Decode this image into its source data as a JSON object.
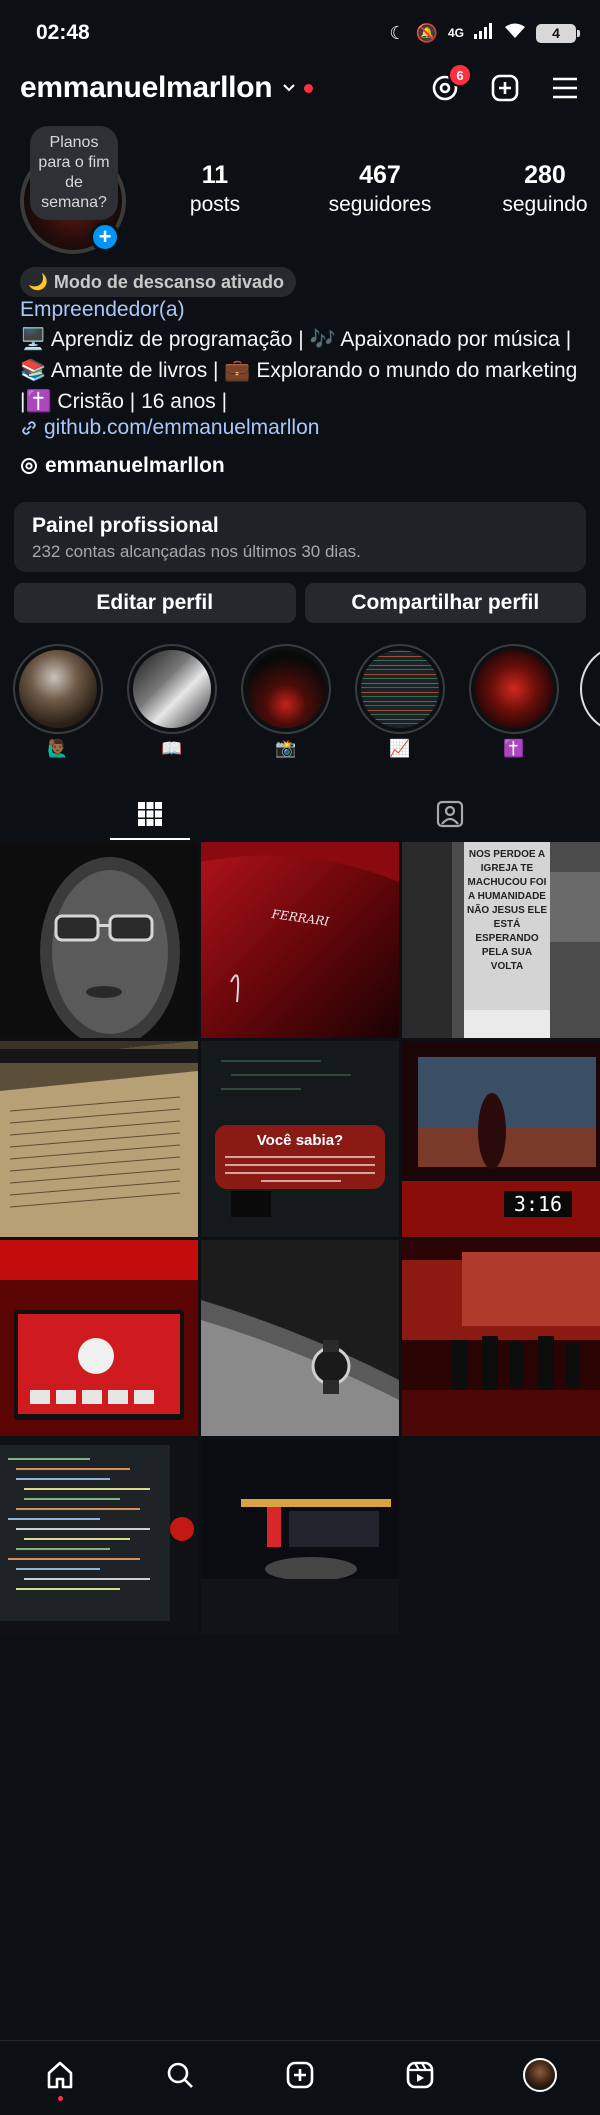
{
  "status_bar": {
    "time": "02:48",
    "network": "4G",
    "battery": "4"
  },
  "header": {
    "username": "emmanuelmarllon",
    "threads_badge": "6",
    "icons": [
      "threads-icon",
      "plus-square-icon",
      "menu-icon"
    ]
  },
  "profile": {
    "note": "Planos para o fim de semana?",
    "stats": [
      {
        "value": "11",
        "label": "posts"
      },
      {
        "value": "467",
        "label": "seguidores"
      },
      {
        "value": "280",
        "label": "seguindo"
      }
    ],
    "rest_mode": "Modo de descanso ativado",
    "category": "Empreendedor(a)",
    "bio": "🖥️ Aprendiz de programação | 🎶 Apaixonado por música | 📚 Amante de livros | 💼 Explorando o mundo do marketing |✝️ Cristão | 16 anos |",
    "link": "github.com/emmanuelmarllon",
    "threads_handle": "emmanuelmarllon"
  },
  "pro_panel": {
    "title": "Painel profissional",
    "subtitle": "232 contas alcançadas nos últimos 30 dias."
  },
  "buttons": {
    "edit": "Editar perfil",
    "share": "Compartilhar perfil"
  },
  "highlights": [
    {
      "label": "🙋🏾‍♂️"
    },
    {
      "label": "📖"
    },
    {
      "label": "📸"
    },
    {
      "label": "📈"
    },
    {
      "label": "✝️"
    }
  ],
  "posts": [
    {
      "caption": ""
    },
    {
      "caption": "FERRARI"
    },
    {
      "caption": "NOS PERDOE A IGREJA TE MACHUCOU FOI A HUMANIDADE NÃO JESUS ELE ESTÁ ESPERANDO PELA SUA VOLTA"
    },
    {
      "caption": ""
    },
    {
      "caption": "Você sabia?"
    },
    {
      "caption": "3:16"
    },
    {
      "caption": ""
    },
    {
      "caption": ""
    },
    {
      "caption": ""
    },
    {
      "caption": ""
    },
    {
      "caption": ""
    }
  ],
  "colors": {
    "background": "#0c1014",
    "link": "#a8c7fa",
    "badge": "#ff3040",
    "accent_blue": "#0095f6",
    "button_bg": "#25292e"
  }
}
